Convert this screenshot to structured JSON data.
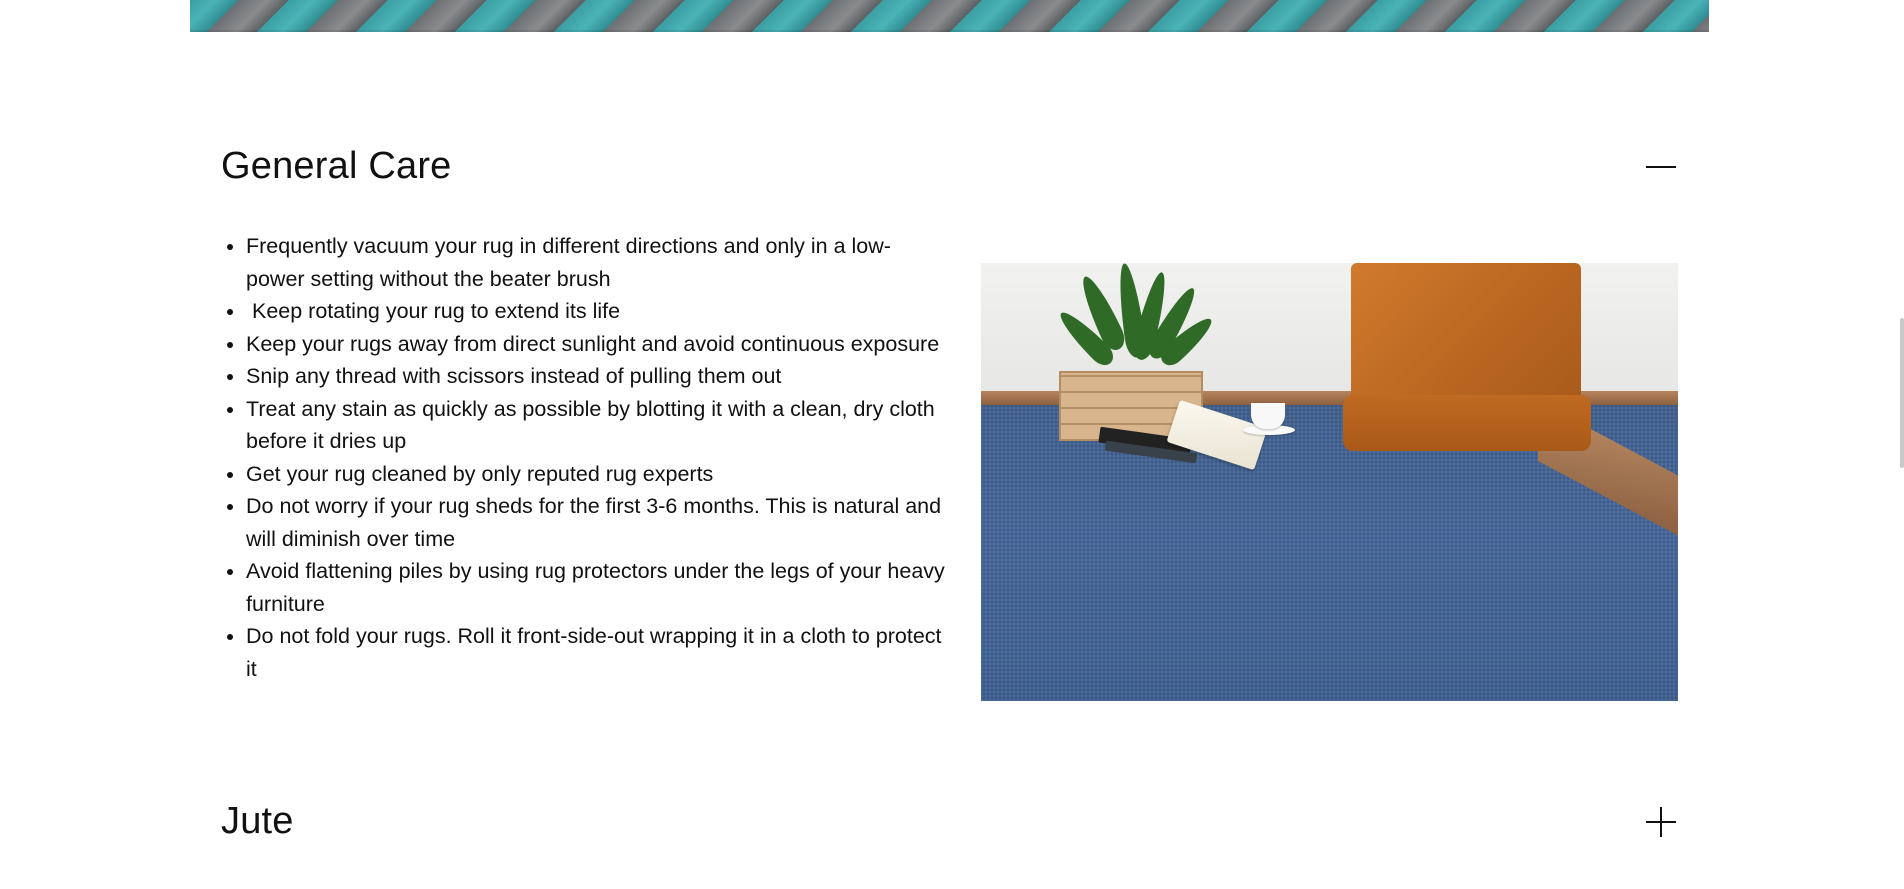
{
  "general_care": {
    "title": "General Care",
    "toggle_icon": "minus-icon",
    "tips": [
      "Frequently vacuum your rug in different directions and only in a low-power setting without the beater brush",
      " Keep rotating your rug to extend its life",
      "Keep your rugs away from direct sunlight and avoid continuous exposure",
      "Snip any thread with scissors instead of pulling them out",
      "Treat any stain as quickly as possible by blotting it with a clean, dry cloth before it dries up",
      "Get your rug cleaned by only reputed rug experts",
      "Do not worry if your rug sheds for the first 3-6 months. This is natural and will diminish over time",
      "Avoid flattening piles by using rug protectors under the legs of your heavy furniture",
      "Do not fold your rugs. Roll it front-side-out wrapping it in a cloth to protect it"
    ],
    "photo_icon": "rug-room-photo"
  },
  "jute": {
    "title": "Jute",
    "toggle_icon": "plus-icon"
  },
  "colors": {
    "text": "#111111",
    "background": "#ffffff",
    "carpet_blue": "#44669a",
    "cushion_orange": "#c06a22",
    "hero_teal": "#3a9ea3",
    "hero_gray": "#6d7072"
  }
}
